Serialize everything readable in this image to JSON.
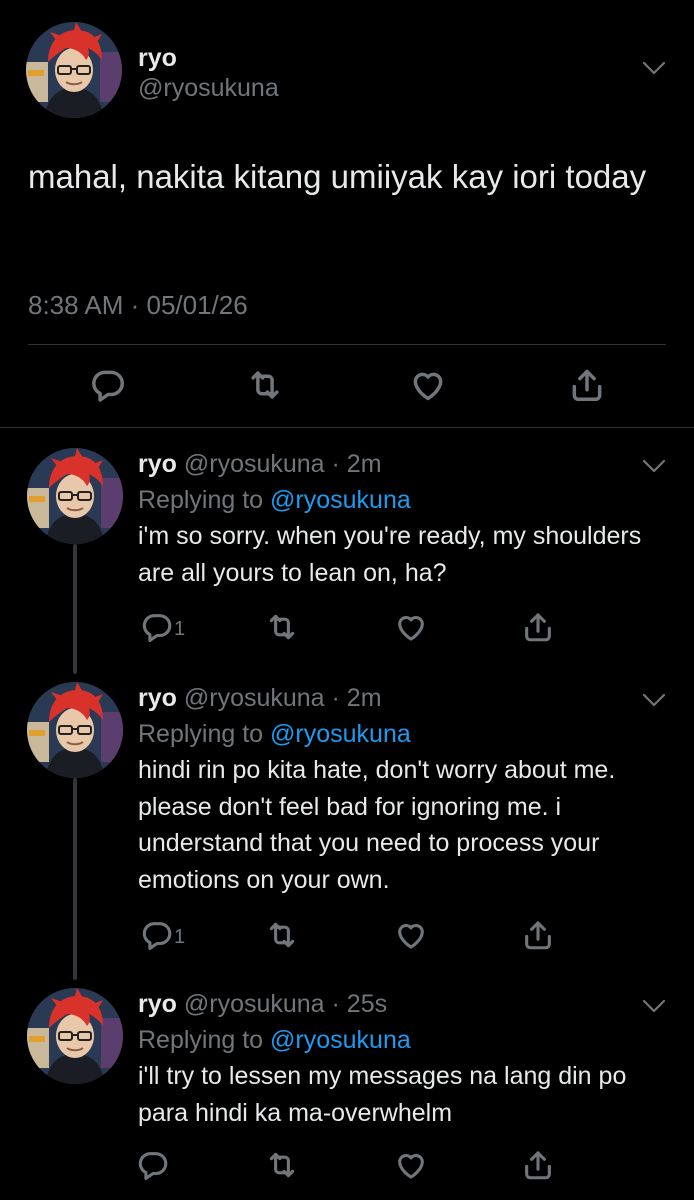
{
  "main_tweet": {
    "name": "ryo",
    "handle": "@ryosukuna",
    "text": "mahal, nakita kitang umiiyak kay iori today",
    "timestamp": "8:38 AM · 05/01/26",
    "actions": [
      "reply-icon",
      "retweet-icon",
      "like-icon",
      "share-icon"
    ]
  },
  "replies": [
    {
      "name": "ryo",
      "meta": "@ryosukuna · 2m",
      "replying_label": "Replying to",
      "replying_to": "@ryosukuna",
      "text": "i'm so sorry. when you're ready, my shoulders are all yours to lean on, ha?",
      "reply_count": "1"
    },
    {
      "name": "ryo",
      "meta": "@ryosukuna · 2m",
      "replying_label": "Replying to",
      "replying_to": "@ryosukuna",
      "text": "hindi rin po kita hate, don't worry about me. please don't feel bad for ignoring me. i understand that you need to process your emotions on your own.",
      "reply_count": "1"
    },
    {
      "name": "ryo",
      "meta": "@ryosukuna · 25s",
      "replying_label": "Replying to",
      "replying_to": "@ryosukuna",
      "text": "i'll try to lessen my messages na lang din po para hindi ka ma-overwhelm",
      "reply_count": ""
    }
  ],
  "colors": {
    "background": "#000000",
    "text": "#e7e9ea",
    "muted": "#71767b",
    "link": "#1d9bf0",
    "divider": "#2f3336",
    "avatar_hair": "#d8322a"
  }
}
